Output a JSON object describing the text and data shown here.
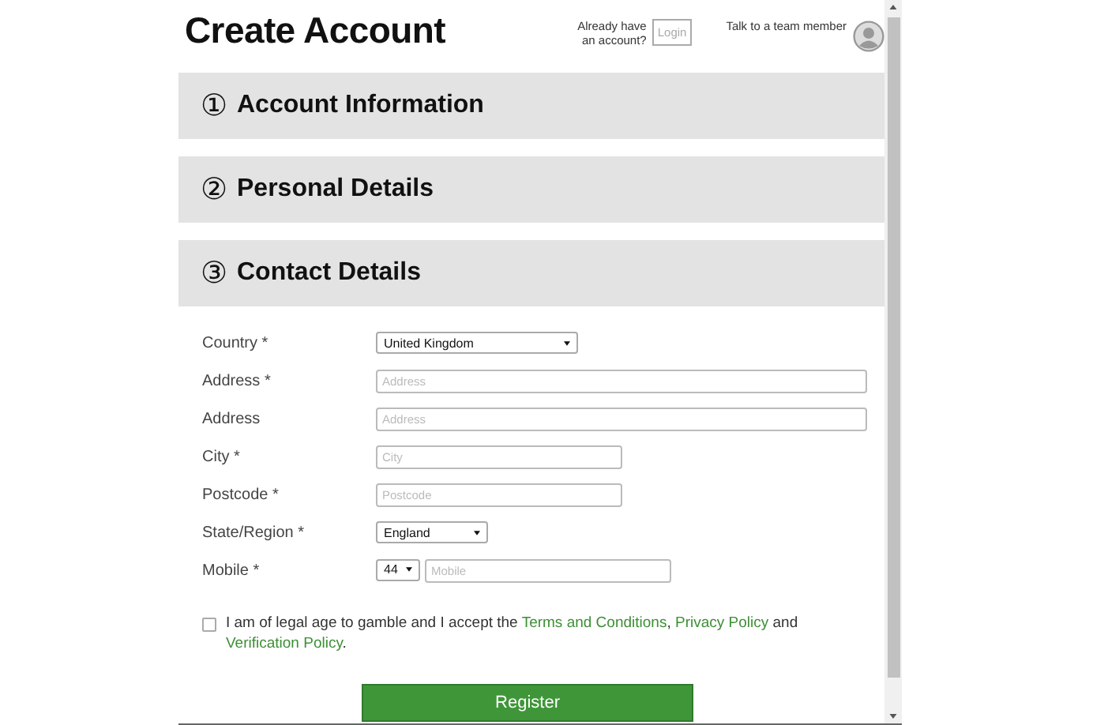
{
  "title": "Create Account",
  "login_prompt": {
    "text": "Already have an account?",
    "button": "Login"
  },
  "contact": {
    "text": "Talk to a team member"
  },
  "sections": [
    {
      "number": "①",
      "title": "Account Information"
    },
    {
      "number": "②",
      "title": "Personal Details"
    },
    {
      "number": "③",
      "title": "Contact Details",
      "fields": [
        {
          "label": "Country *",
          "controls": [
            {
              "kind": "select",
              "value": "United Kingdom"
            }
          ]
        },
        {
          "label": "Address *",
          "controls": [
            {
              "kind": "long-input",
              "placeholder": "Address"
            }
          ]
        },
        {
          "label": "Address",
          "controls": [
            {
              "kind": "long-input",
              "placeholder": "Address"
            }
          ]
        },
        {
          "label": "City *",
          "controls": [
            {
              "kind": "short-input",
              "placeholder": "City"
            }
          ]
        },
        {
          "label": "Postcode *",
          "controls": [
            {
              "kind": "short-input",
              "placeholder": "Postcode"
            }
          ]
        },
        {
          "label": "State/Region *",
          "controls": [
            {
              "kind": "small-select",
              "value": "England"
            }
          ]
        },
        {
          "label": "Mobile *",
          "controls": [
            {
              "kind": "code-select",
              "value": "44"
            },
            {
              "kind": "mobile-input",
              "placeholder": "Mobile"
            }
          ]
        }
      ]
    }
  ],
  "consent": {
    "checked": false,
    "parts": [
      {
        "kind": "text",
        "text": "I am of legal age to gamble and I accept the "
      },
      {
        "kind": "link",
        "text": "Terms and Conditions"
      },
      {
        "kind": "text",
        "text": ", "
      },
      {
        "kind": "link",
        "text": "Privacy Policy"
      },
      {
        "kind": "text",
        "text": " and "
      },
      {
        "kind": "link",
        "text": "Verification Policy"
      },
      {
        "kind": "text",
        "text": "."
      }
    ]
  },
  "register_button": "Register"
}
